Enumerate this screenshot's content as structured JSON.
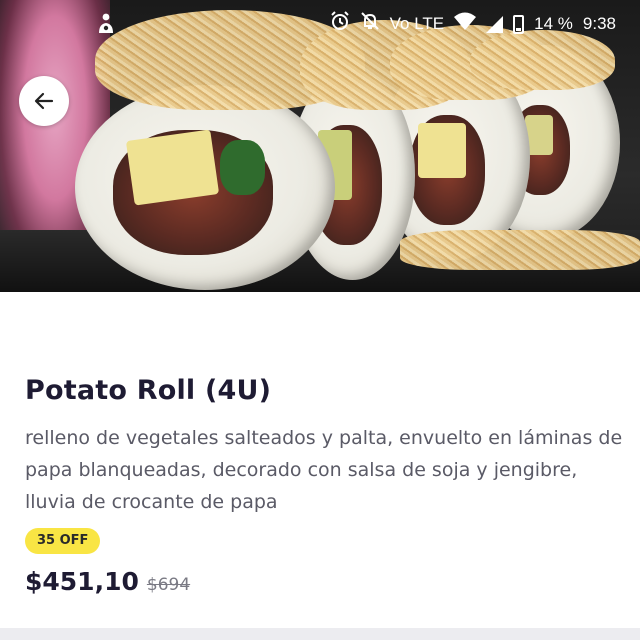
{
  "status_bar": {
    "notification_icon": "app-notification-icon",
    "alarm_icon": "alarm-icon",
    "mute_icon": "bell-off-icon",
    "network_label": "Vo LTE",
    "wifi_icon": "wifi-icon",
    "signal_icon": "signal-icon",
    "battery_percent": "14 %",
    "time": "9:38"
  },
  "hero": {
    "image": "sushi-roll-photo",
    "back_icon": "arrow-left-icon"
  },
  "product": {
    "title": "Potato Roll (4U)",
    "description": "relleno de vegetales salteados y palta, envuelto en láminas de papa blanqueadas, decorado con salsa de soja y jengibre, lluvia de crocante de papa",
    "discount_badge": "35 OFF",
    "price": "$451,10",
    "original_price": "$694"
  },
  "colors": {
    "badge_bg": "#f9e544",
    "title": "#1e1b33",
    "description": "#5a5a66"
  }
}
